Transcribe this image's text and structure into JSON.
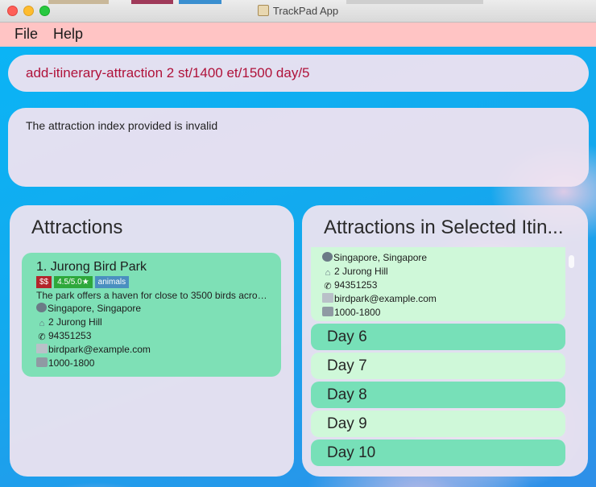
{
  "window": {
    "title": "TrackPad App"
  },
  "menu": {
    "file": "File",
    "help": "Help"
  },
  "command": {
    "value": "add-itinerary-attraction 2 st/1400 et/1500 day/5"
  },
  "result": {
    "text": "The attraction index provided is invalid"
  },
  "attractions_panel": {
    "title": "Attractions",
    "items": [
      {
        "name": "1.  Jurong Bird Park",
        "price": "$$",
        "rating": "4.5/5.0★",
        "category": "animals",
        "description": "The park offers a haven for close to 3500 birds acro…",
        "location": "Singapore, Singapore",
        "address": "2 Jurong Hill",
        "phone": "94351253",
        "email": "birdpark@example.com",
        "hours": "1000-1800"
      }
    ]
  },
  "itinerary_panel": {
    "title": "Attractions in Selected Itin...",
    "partial_card": {
      "location": "Singapore, Singapore",
      "address": "2 Jurong Hill",
      "phone": "94351253",
      "email": "birdpark@example.com",
      "hours": "1000-1800"
    },
    "days": [
      "Day 6",
      "Day 7",
      "Day 8",
      "Day 9",
      "Day 10"
    ]
  },
  "icons": {
    "location": "globe-icon",
    "address": "house-icon",
    "phone": "phone-icon",
    "email": "envelope-icon",
    "hours": "clock-icon"
  },
  "colors": {
    "menubar": "#ffc4c4",
    "command_text": "#b0123a",
    "card_green": "#7ee0b6",
    "card_light": "#cff8d9",
    "price_tag": "#b3242a",
    "rating_tag": "#2ea83b",
    "category_tag": "#4a8fc0"
  }
}
